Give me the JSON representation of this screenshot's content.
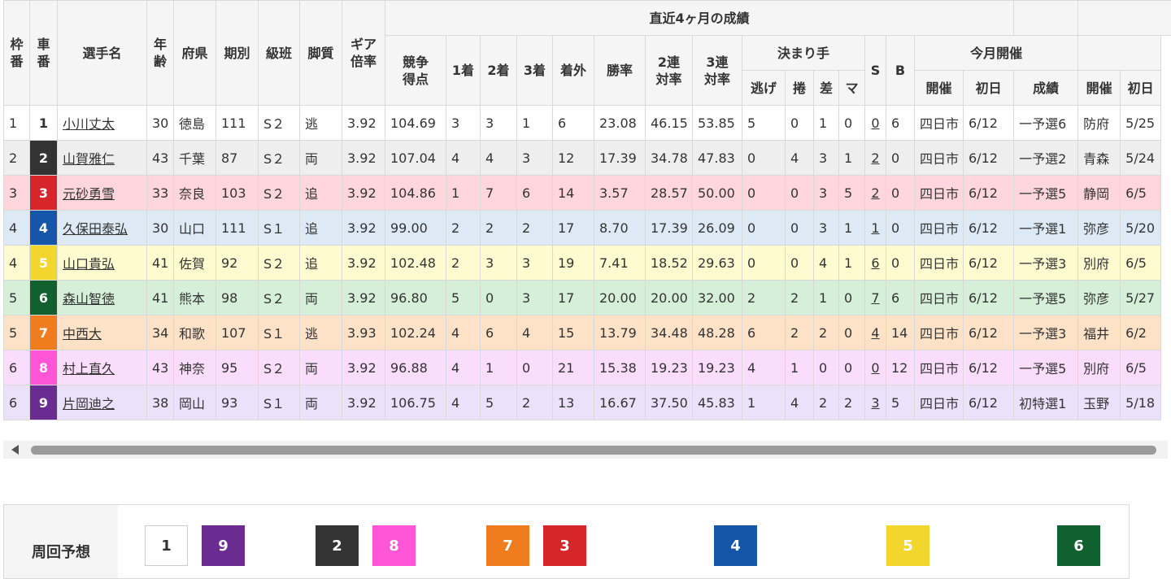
{
  "colors": {
    "rows": [
      "#ffffff",
      "#eeeeee",
      "#ffd6dc",
      "#ddeaf6",
      "#fefbd0",
      "#d6efd8",
      "#fde2c7",
      "#fadcfb",
      "#ece1fb"
    ],
    "car_bg": {
      "1": "#ffffff",
      "2": "#333333",
      "3": "#d6262b",
      "4": "#1556a8",
      "5": "#f2d62e",
      "6": "#11612f",
      "7": "#ef7d20",
      "8": "#ff55d7",
      "9": "#6a2c91"
    },
    "car_fg": {
      "1": "#333333",
      "2": "#ffffff",
      "3": "#ffffff",
      "4": "#ffffff",
      "5": "#ffffff",
      "6": "#ffffff",
      "7": "#ffffff",
      "8": "#ffffff",
      "9": "#ffffff"
    }
  },
  "headers": {
    "waku": "枠番",
    "car": "車番",
    "name": "選手名",
    "age": "年齢",
    "pref": "府県",
    "term": "期別",
    "class": "級班",
    "style": "脚質",
    "gear": "ギア倍率",
    "recent": "直近4ヶ月の成績",
    "score": "競争得点",
    "first": "1着",
    "second": "2着",
    "third": "3着",
    "out": "着外",
    "win": "勝率",
    "ren2": "2連対率",
    "ren3": "3連対率",
    "kimarite": "決まり手",
    "nige": "逃げ",
    "makuri": "捲",
    "sashi": "差",
    "ma": "マ",
    "s": "S",
    "b": "B",
    "month": "今月開催",
    "kaisai": "開催",
    "shonichi": "初日",
    "seiseki": "成績",
    "kaisai2": "開催",
    "shonichi2": "初日"
  },
  "rows": [
    {
      "waku": "1",
      "car": "1",
      "name": "小川丈太",
      "age": "30",
      "pref": "徳島",
      "term": "111",
      "class": "S２",
      "style": "逃",
      "gear": "3.92",
      "score": "104.69",
      "first": "3",
      "second": "3",
      "third": "1",
      "out": "6",
      "win": "23.08",
      "ren2": "46.15",
      "ren3": "53.85",
      "nige": "5",
      "makuri": "0",
      "sashi": "1",
      "ma": "0",
      "s": "0",
      "b": "6",
      "kaisai": "四日市",
      "shonichi": "6/12",
      "seiseki": "一予選6",
      "kaisai2": "防府",
      "shonichi2": "5/25"
    },
    {
      "waku": "2",
      "car": "2",
      "name": "山賀雅仁",
      "age": "43",
      "pref": "千葉",
      "term": "87",
      "class": "S２",
      "style": "両",
      "gear": "3.92",
      "score": "107.04",
      "first": "4",
      "second": "4",
      "third": "3",
      "out": "12",
      "win": "17.39",
      "ren2": "34.78",
      "ren3": "47.83",
      "nige": "0",
      "makuri": "4",
      "sashi": "3",
      "ma": "1",
      "s": "2",
      "b": "0",
      "kaisai": "四日市",
      "shonichi": "6/12",
      "seiseki": "一予選2",
      "kaisai2": "青森",
      "shonichi2": "5/24"
    },
    {
      "waku": "3",
      "car": "3",
      "name": "元砂勇雪",
      "age": "33",
      "pref": "奈良",
      "term": "103",
      "class": "S２",
      "style": "追",
      "gear": "3.92",
      "score": "104.86",
      "first": "1",
      "second": "7",
      "third": "6",
      "out": "14",
      "win": "3.57",
      "ren2": "28.57",
      "ren3": "50.00",
      "nige": "0",
      "makuri": "0",
      "sashi": "3",
      "ma": "5",
      "s": "2",
      "b": "0",
      "kaisai": "四日市",
      "shonichi": "6/12",
      "seiseki": "一予選5",
      "kaisai2": "静岡",
      "shonichi2": "6/5"
    },
    {
      "waku": "4",
      "car": "4",
      "name": "久保田泰弘",
      "age": "30",
      "pref": "山口",
      "term": "111",
      "class": "S１",
      "style": "追",
      "gear": "3.92",
      "score": "99.00",
      "first": "2",
      "second": "2",
      "third": "2",
      "out": "17",
      "win": "8.70",
      "ren2": "17.39",
      "ren3": "26.09",
      "nige": "0",
      "makuri": "0",
      "sashi": "3",
      "ma": "1",
      "s": "1",
      "b": "0",
      "kaisai": "四日市",
      "shonichi": "6/12",
      "seiseki": "一予選1",
      "kaisai2": "弥彦",
      "shonichi2": "5/20"
    },
    {
      "waku": "4",
      "car": "5",
      "name": "山口貴弘",
      "age": "41",
      "pref": "佐賀",
      "term": "92",
      "class": "S２",
      "style": "追",
      "gear": "3.92",
      "score": "102.48",
      "first": "2",
      "second": "3",
      "third": "3",
      "out": "19",
      "win": "7.41",
      "ren2": "18.52",
      "ren3": "29.63",
      "nige": "0",
      "makuri": "0",
      "sashi": "4",
      "ma": "1",
      "s": "6",
      "b": "0",
      "kaisai": "四日市",
      "shonichi": "6/12",
      "seiseki": "一予選3",
      "kaisai2": "別府",
      "shonichi2": "6/5"
    },
    {
      "waku": "5",
      "car": "6",
      "name": "森山智徳",
      "age": "41",
      "pref": "熊本",
      "term": "98",
      "class": "S２",
      "style": "両",
      "gear": "3.92",
      "score": "96.80",
      "first": "5",
      "second": "0",
      "third": "3",
      "out": "17",
      "win": "20.00",
      "ren2": "20.00",
      "ren3": "32.00",
      "nige": "2",
      "makuri": "2",
      "sashi": "1",
      "ma": "0",
      "s": "7",
      "b": "6",
      "kaisai": "四日市",
      "shonichi": "6/12",
      "seiseki": "一予選5",
      "kaisai2": "弥彦",
      "shonichi2": "5/27"
    },
    {
      "waku": "5",
      "car": "7",
      "name": "中西大",
      "age": "34",
      "pref": "和歌",
      "term": "107",
      "class": "S１",
      "style": "逃",
      "gear": "3.93",
      "score": "102.24",
      "first": "4",
      "second": "6",
      "third": "4",
      "out": "15",
      "win": "13.79",
      "ren2": "34.48",
      "ren3": "48.28",
      "nige": "6",
      "makuri": "2",
      "sashi": "2",
      "ma": "0",
      "s": "4",
      "b": "14",
      "kaisai": "四日市",
      "shonichi": "6/12",
      "seiseki": "一予選3",
      "kaisai2": "福井",
      "shonichi2": "6/2"
    },
    {
      "waku": "6",
      "car": "8",
      "name": "村上直久",
      "age": "43",
      "pref": "神奈",
      "term": "95",
      "class": "S２",
      "style": "両",
      "gear": "3.92",
      "score": "96.88",
      "first": "4",
      "second": "1",
      "third": "0",
      "out": "21",
      "win": "15.38",
      "ren2": "19.23",
      "ren3": "19.23",
      "nige": "4",
      "makuri": "1",
      "sashi": "0",
      "ma": "0",
      "s": "0",
      "b": "12",
      "kaisai": "四日市",
      "shonichi": "6/12",
      "seiseki": "一予選5",
      "kaisai2": "別府",
      "shonichi2": "6/5"
    },
    {
      "waku": "6",
      "car": "9",
      "name": "片岡迪之",
      "age": "38",
      "pref": "岡山",
      "term": "93",
      "class": "S１",
      "style": "両",
      "gear": "3.92",
      "score": "106.75",
      "first": "4",
      "second": "5",
      "third": "2",
      "out": "13",
      "win": "16.67",
      "ren2": "37.50",
      "ren3": "45.83",
      "nige": "1",
      "makuri": "4",
      "sashi": "2",
      "ma": "2",
      "s": "3",
      "b": "5",
      "kaisai": "四日市",
      "shonichi": "6/12",
      "seiseki": "初特選1",
      "kaisai2": "玉野",
      "shonichi2": "5/18"
    }
  ],
  "prediction": {
    "label": "周回予想",
    "boxes": [
      "1",
      "9",
      "2",
      "8",
      "7",
      "3",
      "4",
      "5",
      "6"
    ]
  }
}
